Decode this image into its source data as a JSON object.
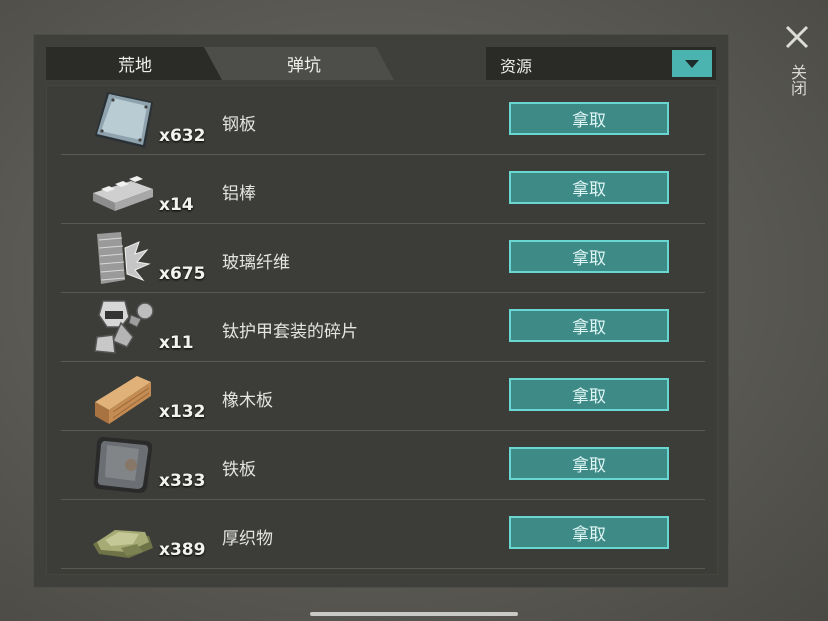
{
  "close": {
    "label": "关闭",
    "icon": "close-x-icon"
  },
  "tabs": [
    {
      "label": "荒地"
    },
    {
      "label": "弹坑"
    }
  ],
  "filter": {
    "selected": "资源",
    "icon": "triangle-down-icon"
  },
  "items": [
    {
      "name": "钢板",
      "qty": "x632",
      "icon": "steel-plate-icon",
      "action": "拿取"
    },
    {
      "name": "铝棒",
      "qty": "x14",
      "icon": "aluminum-bar-icon",
      "action": "拿取"
    },
    {
      "name": "玻璃纤维",
      "qty": "x675",
      "icon": "fiberglass-icon",
      "action": "拿取"
    },
    {
      "name": "钛护甲套装的碎片",
      "qty": "x11",
      "icon": "titanium-armor-fragment-icon",
      "action": "拿取"
    },
    {
      "name": "橡木板",
      "qty": "x132",
      "icon": "oak-plank-icon",
      "action": "拿取"
    },
    {
      "name": "铁板",
      "qty": "x333",
      "icon": "iron-plate-icon",
      "action": "拿取"
    },
    {
      "name": "厚织物",
      "qty": "x389",
      "icon": "thick-fabric-icon",
      "action": "拿取"
    }
  ],
  "colors": {
    "accent": "#4bb3b0",
    "button_fill": "#3d8a87",
    "panel": "#3f3f3b"
  }
}
